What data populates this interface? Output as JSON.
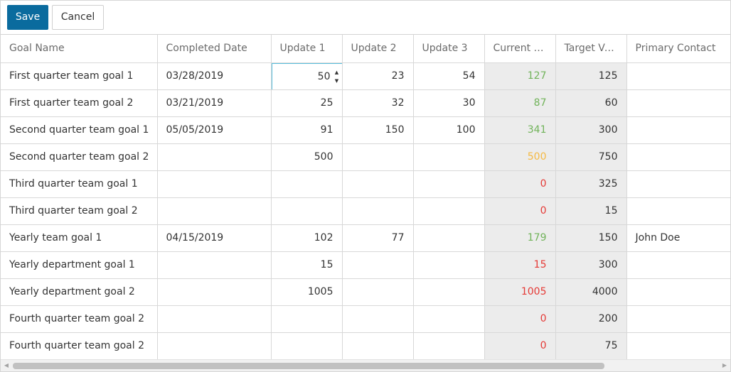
{
  "toolbar": {
    "save_label": "Save",
    "cancel_label": "Cancel"
  },
  "columns": [
    "Goal Name",
    "Completed Date",
    "Update 1",
    "Update 2",
    "Update 3",
    "Current T...",
    "Target Va...",
    "Primary Contact"
  ],
  "editor": {
    "value": "50",
    "up_glyph": "▲",
    "down_glyph": "▼"
  },
  "colors": {
    "green": "#71b35a",
    "orange": "#f5b942",
    "red": "#e53935",
    "accent": "#0a6b9e"
  },
  "rows": [
    {
      "name": "First quarter team goal 1",
      "date": "03/28/2019",
      "u1": "50",
      "u2": "23",
      "u3": "54",
      "current": "127",
      "target": "125",
      "contact": "",
      "status": "green"
    },
    {
      "name": "First quarter team goal 2",
      "date": "03/21/2019",
      "u1": "25",
      "u2": "32",
      "u3": "30",
      "current": "87",
      "target": "60",
      "contact": "",
      "status": "green"
    },
    {
      "name": "Second quarter team goal 1",
      "date": "05/05/2019",
      "u1": "91",
      "u2": "150",
      "u3": "100",
      "current": "341",
      "target": "300",
      "contact": "",
      "status": "green"
    },
    {
      "name": "Second quarter team goal 2",
      "date": "",
      "u1": "500",
      "u2": "",
      "u3": "",
      "current": "500",
      "target": "750",
      "contact": "",
      "status": "orange"
    },
    {
      "name": "Third quarter team goal 1",
      "date": "",
      "u1": "",
      "u2": "",
      "u3": "",
      "current": "0",
      "target": "325",
      "contact": "",
      "status": "red"
    },
    {
      "name": "Third quarter team goal 2",
      "date": "",
      "u1": "",
      "u2": "",
      "u3": "",
      "current": "0",
      "target": "15",
      "contact": "",
      "status": "red"
    },
    {
      "name": "Yearly team goal 1",
      "date": "04/15/2019",
      "u1": "102",
      "u2": "77",
      "u3": "",
      "current": "179",
      "target": "150",
      "contact": "John Doe",
      "status": "green"
    },
    {
      "name": "Yearly department goal 1",
      "date": "",
      "u1": "15",
      "u2": "",
      "u3": "",
      "current": "15",
      "target": "300",
      "contact": "",
      "status": "red"
    },
    {
      "name": "Yearly department goal 2",
      "date": "",
      "u1": "1005",
      "u2": "",
      "u3": "",
      "current": "1005",
      "target": "4000",
      "contact": "",
      "status": "red"
    },
    {
      "name": "Fourth quarter team goal 2",
      "date": "",
      "u1": "",
      "u2": "",
      "u3": "",
      "current": "0",
      "target": "200",
      "contact": "",
      "status": "red"
    },
    {
      "name": "Fourth quarter team goal 2",
      "date": "",
      "u1": "",
      "u2": "",
      "u3": "",
      "current": "0",
      "target": "75",
      "contact": "",
      "status": "red"
    }
  ],
  "scrollbar": {
    "left_glyph": "◀",
    "right_glyph": "▶"
  }
}
